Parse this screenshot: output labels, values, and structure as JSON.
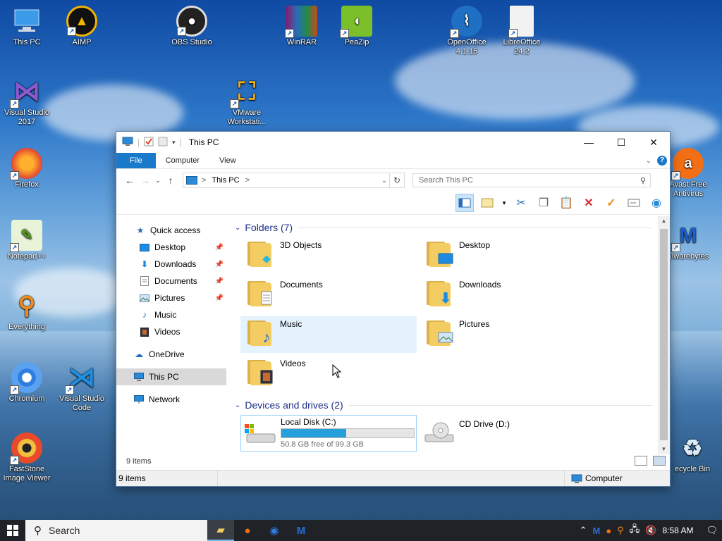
{
  "desktop": {
    "icons": [
      {
        "label": "This PC"
      },
      {
        "label": "AIMP"
      },
      {
        "label": "OBS Studio"
      },
      {
        "label": "WinRAR"
      },
      {
        "label": "PeaZip"
      },
      {
        "label": "OpenOffice 4.1.15"
      },
      {
        "label": "LibreOffice 24.2"
      },
      {
        "label": "Visual Studio 2017"
      },
      {
        "label": "VMware Workstati..."
      },
      {
        "label": "Firefox"
      },
      {
        "label": "Avast Free Antivirus"
      },
      {
        "label": "Notepad++"
      },
      {
        "label": "alwarebytes"
      },
      {
        "label": "Everything"
      },
      {
        "label": "Chromium"
      },
      {
        "label": "Visual Studio Code"
      },
      {
        "label": "FastStone Image Viewer"
      },
      {
        "label": "ecycle Bin"
      }
    ]
  },
  "window": {
    "title": "This PC",
    "tabs": {
      "file": "File",
      "computer": "Computer",
      "view": "View"
    },
    "help": "?",
    "address": {
      "location": "This PC",
      "sep": ">"
    },
    "search_placeholder": "Search This PC",
    "nav": {
      "quick_access": "Quick access",
      "desktop": "Desktop",
      "downloads": "Downloads",
      "documents": "Documents",
      "pictures": "Pictures",
      "music": "Music",
      "videos": "Videos",
      "onedrive": "OneDrive",
      "this_pc": "This PC",
      "network": "Network"
    },
    "folders_header": "Folders (7)",
    "folders": {
      "objects3d": "3D Objects",
      "desktop": "Desktop",
      "documents": "Documents",
      "downloads": "Downloads",
      "music": "Music",
      "pictures": "Pictures",
      "videos": "Videos"
    },
    "devices_header": "Devices and drives (2)",
    "drives": {
      "c_name": "Local Disk (C:)",
      "c_free": "50.8 GB free of 99.3 GB",
      "c_used_fraction": 0.49,
      "d_name": "CD Drive (D:)"
    },
    "item_count": "9 items",
    "status": {
      "items": "9 items",
      "location": "Computer"
    }
  },
  "taskbar": {
    "search": "Search",
    "time": "8:58 AM"
  },
  "colors": {
    "accent": "#1979ca",
    "progress": "#26a0da",
    "folder": "#f4cd62"
  }
}
